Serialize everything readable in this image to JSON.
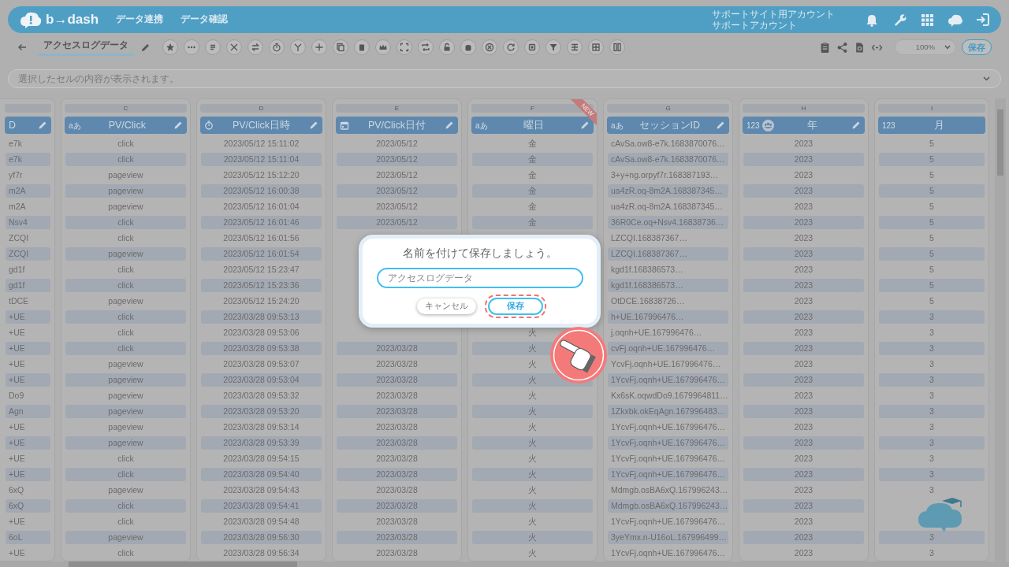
{
  "header": {
    "logo": "b→dash",
    "nav": [
      "データ連携",
      "データ確認"
    ],
    "account": [
      "サポートサイト用アカウント",
      "サポートアカウント"
    ]
  },
  "toolbar": {
    "title": "アクセスログデータ",
    "zoom": "100%",
    "save": "保存"
  },
  "cell_preview": {
    "placeholder": "選択したセルの内容が表示されます。"
  },
  "table": {
    "columns": [
      {
        "name": "D",
        "editable": true
      },
      {
        "letter": "C",
        "name": "PV/Click",
        "kind": "text",
        "type_label": "aあ",
        "editable": true
      },
      {
        "letter": "D",
        "name": "PV/Click日時",
        "kind": "datetime",
        "editable": true
      },
      {
        "letter": "E",
        "name": "PV/Click日付",
        "kind": "date",
        "editable": true
      },
      {
        "letter": "F",
        "name": "曜日",
        "kind": "text",
        "type_label": "aあ",
        "editable": true,
        "badge": "NEW"
      },
      {
        "letter": "G",
        "name": "セッションID",
        "kind": "text",
        "type_label": "aあ",
        "editable": true
      },
      {
        "letter": "H",
        "name": "年",
        "kind": "number",
        "type_label": "123",
        "grouped": true,
        "editable": true
      },
      {
        "letter": "I",
        "name": "月",
        "kind": "number",
        "type_label": "123",
        "editable": false
      }
    ],
    "rows": [
      [
        "e7k",
        "click",
        "2023/05/12 15:11:02",
        "2023/05/12",
        "金",
        "cAvSa.ow8-e7k.1683870076…",
        "2023",
        "5"
      ],
      [
        "e7k",
        "click",
        "2023/05/12 15:11:04",
        "2023/05/12",
        "金",
        "cAvSa.ow8-e7k.1683870076…",
        "2023",
        "5"
      ],
      [
        "yf7r",
        "pageview",
        "2023/05/12 15:12:20",
        "2023/05/12",
        "金",
        "3+y+ng.orpyf7r.168387193…",
        "2023",
        "5"
      ],
      [
        "m2A",
        "pageview",
        "2023/05/12 16:00:38",
        "2023/05/12",
        "金",
        "ua4zR.oq-8m2A.168387345…",
        "2023",
        "5"
      ],
      [
        "m2A",
        "pageview",
        "2023/05/12 16:01:04",
        "2023/05/12",
        "金",
        "ua4zR.oq-8m2A.168387345…",
        "2023",
        "5"
      ],
      [
        "Nsv4",
        "click",
        "2023/05/12 16:01:46",
        "2023/05/12",
        "金",
        "36R0Ce.oq+Nsv4.16838736…",
        "2023",
        "5"
      ],
      [
        "ZCQI",
        "click",
        "2023/05/12 16:01:56",
        null,
        null,
        "LZCQI.168387367…",
        "2023",
        "5"
      ],
      [
        "ZCQI",
        "pageview",
        "2023/05/12 16:01:54",
        null,
        null,
        "LZCQI.168387367…",
        "2023",
        "5"
      ],
      [
        "gd1f",
        "click",
        "2023/05/12 15:23:47",
        null,
        null,
        "kgd1f.168386573…",
        "2023",
        "5"
      ],
      [
        "gd1f",
        "click",
        "2023/05/12 15:23:36",
        null,
        null,
        "kgd1f.168386573…",
        "2023",
        "5"
      ],
      [
        "tDCE",
        "pageview",
        "2023/05/12 15:24:20",
        null,
        null,
        "OtDCE.16838726…",
        "2023",
        "5"
      ],
      [
        "+UE",
        "click",
        "2023/03/28 09:53:13",
        null,
        null,
        "h+UE.167996476…",
        "2023",
        "3"
      ],
      [
        "+UE",
        "click",
        "2023/03/28 09:53:06",
        null,
        "火",
        "j.oqnh+UE.167996476…",
        "2023",
        "3"
      ],
      [
        "+UE",
        "click",
        "2023/03/28 09:53:38",
        "2023/03/28",
        "火",
        "cvFj.oqnh+UE.167996476…",
        "2023",
        "3"
      ],
      [
        "+UE",
        "pageview",
        "2023/03/28 09:53:07",
        "2023/03/28",
        "火",
        "YcvFj.oqnh+UE.167996476…",
        "2023",
        "3"
      ],
      [
        "+UE",
        "pageview",
        "2023/03/28 09:53:04",
        "2023/03/28",
        "火",
        "1YcvFj.oqnh+UE.167996476…",
        "2023",
        "3"
      ],
      [
        "Do9",
        "pageview",
        "2023/03/28 09:53:32",
        "2023/03/28",
        "火",
        "Kx6sK.oqwdDo9.1679964811…",
        "2023",
        "3"
      ],
      [
        "Agn",
        "pageview",
        "2023/03/28 09:53:20",
        "2023/03/28",
        "火",
        "1Zkxbk.okEqAgn.167996483…",
        "2023",
        "3"
      ],
      [
        "+UE",
        "pageview",
        "2023/03/28 09:53:14",
        "2023/03/28",
        "火",
        "1YcvFj.oqnh+UE.167996476…",
        "2023",
        "3"
      ],
      [
        "+UE",
        "pageview",
        "2023/03/28 09:53:39",
        "2023/03/28",
        "火",
        "1YcvFj.oqnh+UE.167996476…",
        "2023",
        "3"
      ],
      [
        "+UE",
        "click",
        "2023/03/28 09:54:15",
        "2023/03/28",
        "火",
        "1YcvFj.oqnh+UE.167996476…",
        "2023",
        "3"
      ],
      [
        "+UE",
        "click",
        "2023/03/28 09:54:40",
        "2023/03/28",
        "火",
        "1YcvFj.oqnh+UE.167996476…",
        "2023",
        "3"
      ],
      [
        "6xQ",
        "pageview",
        "2023/03/28 09:54:43",
        "2023/03/28",
        "火",
        "Mdmgb.osBA6xQ.167996243…",
        "2023",
        "3"
      ],
      [
        "6xQ",
        "click",
        "2023/03/28 09:54:41",
        "2023/03/28",
        "火",
        "Mdmgb.osBA6xQ.167996243…",
        "2023",
        null
      ],
      [
        "+UE",
        "click",
        "2023/03/28 09:54:48",
        "2023/03/28",
        "火",
        "1YcvFj.oqnh+UE.167996476…",
        "2023",
        null
      ],
      [
        "6oL",
        "pageview",
        "2023/03/28 09:56:30",
        "2023/03/28",
        "火",
        "3yeYmx.n-U16oL.167996499…",
        "2023",
        "3"
      ],
      [
        "+UE",
        "click",
        "2023/03/28 09:56:34",
        "2023/03/28",
        "火",
        "1YcvFj.oqnh+UE.167996476…",
        "2023",
        "3"
      ]
    ]
  },
  "modal": {
    "title": "名前を付けて保存しましょう。",
    "input_value": "アクセスログデータ",
    "buttons": [
      {
        "label": "キャンセル",
        "kind": "cancel",
        "highlighted": false
      },
      {
        "label": "保存",
        "kind": "save",
        "highlighted": true
      }
    ]
  }
}
